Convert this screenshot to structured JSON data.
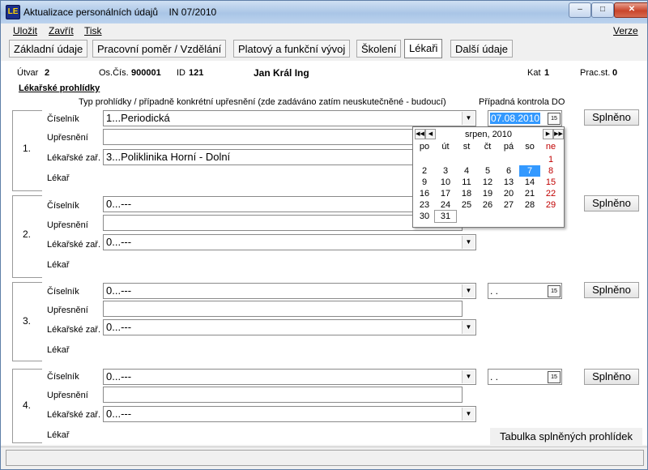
{
  "window": {
    "title": "Aktualizace personálních údajů",
    "period": "IN  07/2010",
    "icon_label": "LE"
  },
  "titlebar_buttons": [
    "minimize-icon",
    "maximize-icon",
    "close-icon"
  ],
  "menu": {
    "save": "Uložit",
    "close": "Zavřít",
    "print": "Tisk",
    "version": "Verze"
  },
  "tabs": [
    {
      "label": "Základní údaje"
    },
    {
      "label": "Pracovní poměr / Vzdělání"
    },
    {
      "label": "Platový a funkční vývoj"
    },
    {
      "label": "Školení"
    },
    {
      "label": "Lékaři"
    },
    {
      "label": "Další údaje"
    }
  ],
  "employee": {
    "utvar_label": "Útvar",
    "utvar": "2",
    "oscis_label": "Os.Čís.",
    "oscis": "900001",
    "id_label": "ID",
    "id": "121",
    "name": "Jan Král Ing",
    "kat_label": "Kat",
    "kat": "1",
    "pracst_label": "Prac.st.",
    "pracst": "0"
  },
  "section_title": "Lékařské prohlídky",
  "col_header": "Typ prohlídky / případně konkrétní upřesnění (zde zadáváno zatím neuskutečněné - budoucí)",
  "date_header": "Případná kontrola DO",
  "labels": {
    "ciselnik": "Číselník",
    "upresneni": "Upřesnění",
    "lekarske": "Lékařské zař.",
    "lekar": "Lékař",
    "done": "Splněno"
  },
  "exams": [
    {
      "num": "1.",
      "ciselnik": "1...Periodická",
      "upresneni": "",
      "lekarske": "3...Poliklinika Horní - Dolní",
      "date": "07.08.2010"
    },
    {
      "num": "2.",
      "ciselnik": "0...---",
      "upresneni": "",
      "lekarske": "0...---",
      "date": ""
    },
    {
      "num": "3.",
      "ciselnik": "0...---",
      "upresneni": "",
      "lekarske": "0...---",
      "date": ". ."
    },
    {
      "num": "4.",
      "ciselnik": "0...---",
      "upresneni": "",
      "lekarske": "0...---",
      "date": ". ."
    }
  ],
  "calendar": {
    "month": "srpen, 2010",
    "weekdays": [
      "po",
      "út",
      "st",
      "čt",
      "pá",
      "so",
      "ne"
    ],
    "selected_day": "7",
    "weeks": [
      [
        "",
        "",
        "",
        "",
        "",
        "",
        "1"
      ],
      [
        "2",
        "3",
        "4",
        "5",
        "6",
        "7",
        "8"
      ],
      [
        "9",
        "10",
        "11",
        "12",
        "13",
        "14",
        "15"
      ],
      [
        "16",
        "17",
        "18",
        "19",
        "20",
        "21",
        "22"
      ],
      [
        "23",
        "24",
        "25",
        "26",
        "27",
        "28",
        "29"
      ],
      [
        "30",
        "31",
        "",
        "",
        "",
        "",
        ""
      ]
    ]
  },
  "table_button": "Tabulka splněných prohlídek"
}
